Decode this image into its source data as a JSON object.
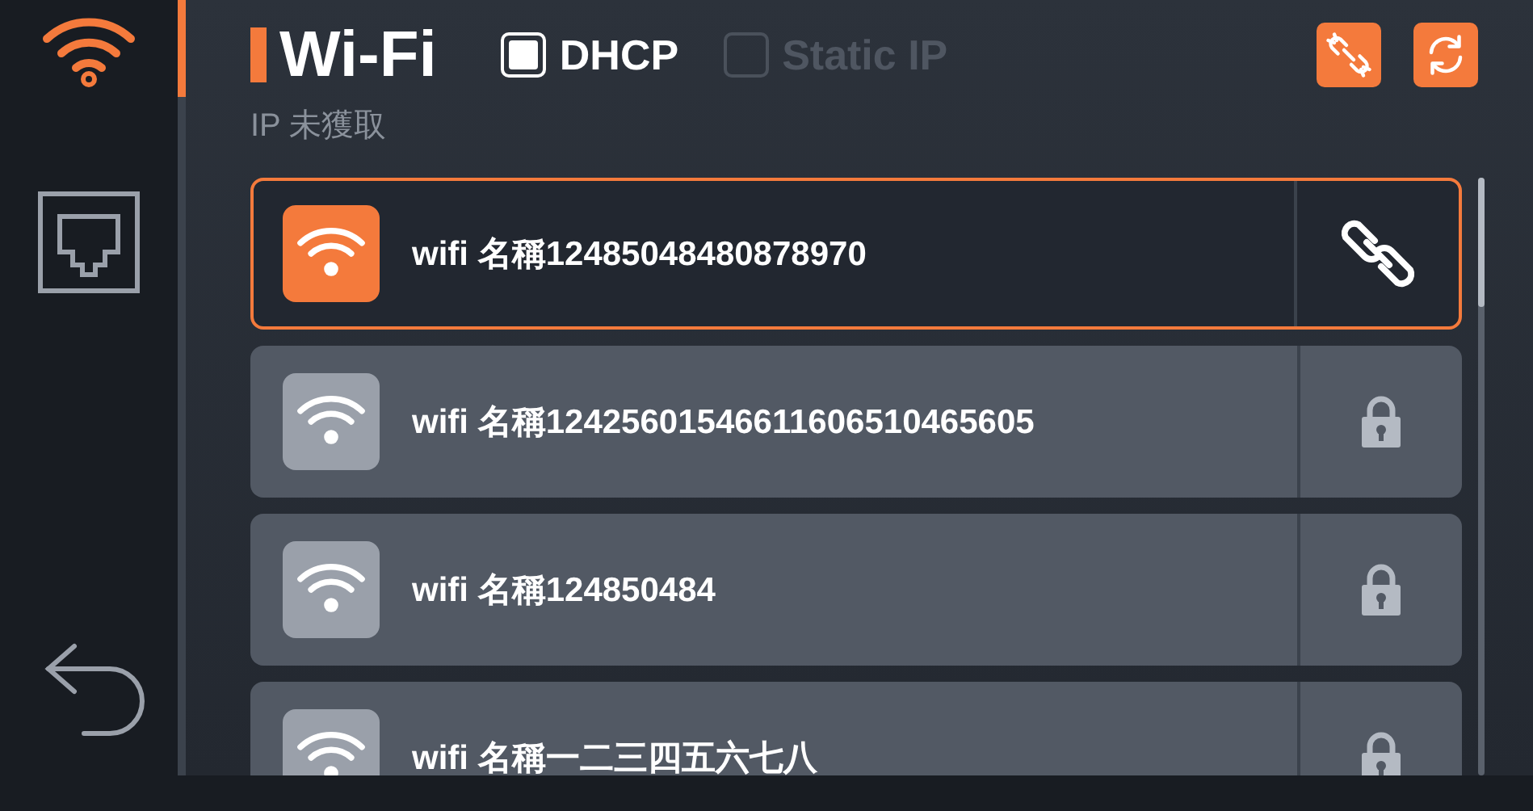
{
  "sidebar": {
    "items": [
      {
        "kind": "wifi",
        "selected": true
      },
      {
        "kind": "ethernet",
        "selected": false
      }
    ],
    "back": {
      "kind": "back"
    }
  },
  "header": {
    "title": "Wi-Fi",
    "modes": [
      {
        "label": "DHCP",
        "checked": true
      },
      {
        "label": "Static IP",
        "checked": false
      }
    ]
  },
  "ip_status": "IP 未獲取",
  "networks": [
    {
      "name": "wifi 名稱12485048480878970",
      "selected": true,
      "kind": "link"
    },
    {
      "name": "wifi 名稱12425601546611606510465605",
      "selected": false,
      "kind": "lock"
    },
    {
      "name": "wifi 名稱124850484",
      "selected": false,
      "kind": "lock"
    },
    {
      "name": "wifi 名稱一二三四五六七八",
      "selected": false,
      "kind": "lock"
    }
  ]
}
